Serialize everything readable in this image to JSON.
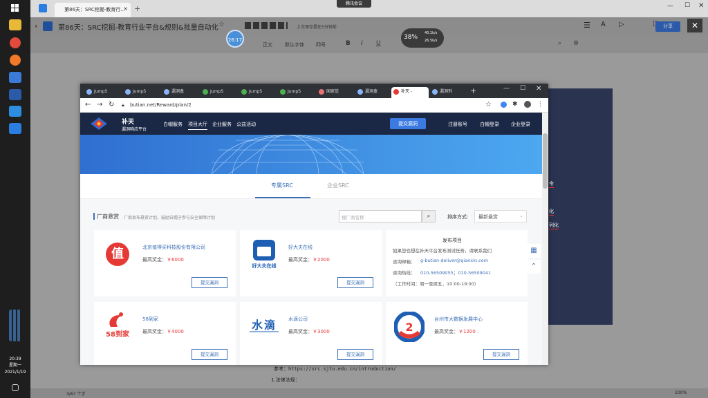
{
  "taskbar": {
    "time": "20:39",
    "weekday": "星期一",
    "date": "2021/1/19"
  },
  "meeting_badge": "腾讯会议",
  "doc_app": {
    "tab_title": "第86天：SRC挖掘-教育行...",
    "title": "第86天：SRC挖掘-教育行业平台&规则&批量自动化",
    "save_status": "上次保存是在5分钟前",
    "share_label": "分享",
    "toolbar": {
      "body_style": "正文",
      "font": "默认字体",
      "size": "四号",
      "bold": "B",
      "italic": "I",
      "underline": "U"
    },
    "timer": "26:17",
    "speed": {
      "percent": "38%",
      "up": "40.1k/s",
      "down": "26.5k/s"
    },
    "side_texts": [
      "令",
      "化",
      "列化"
    ],
    "body_lines": [
      "参考：https://src.sjtu.edu.cn/introduction/",
      "1.法律法规："
    ],
    "status_pages": "3/67 个字",
    "zoom": "100%"
  },
  "browser": {
    "tabs": [
      "JumpS",
      "JumpS",
      "漏洞盒",
      "JumpS",
      "JumpS",
      "JumpS",
      "国家信",
      "漏洞盒",
      "补天 -",
      "漏洞列"
    ],
    "active_tab_index": 8,
    "url": "butian.net/Reward/plan/2"
  },
  "site": {
    "brand": "补天",
    "brand_sub": "漏洞响应平台",
    "nav": [
      "白帽服务",
      "项目大厅",
      "企业服务",
      "公益活动"
    ],
    "submit_vuln": "提交漏洞",
    "register": "注册账号",
    "whitehat_login": "白帽登录",
    "company_login": "企业登录",
    "tabs": [
      "专属SRC",
      "企业SRC"
    ],
    "section_title": "厂商悬赏",
    "section_desc": "厂商发布悬赏计划，鼓励白帽子参与安全保障计划",
    "search_placeholder": "搜厂商名称",
    "sort_label": "排序方式:",
    "sort_value": "最新悬赏",
    "cards": [
      {
        "name": "北京值得买科技股份有限公司",
        "reward_label": "最高奖金：",
        "reward": "￥6000",
        "button": "提交漏洞",
        "logo": "值"
      },
      {
        "name": "好大夫在线",
        "reward_label": "最高奖金：",
        "reward": "￥2000",
        "button": "提交漏洞",
        "logo": "好大夫在线"
      },
      {
        "name": "58到家",
        "reward_label": "最高奖金：",
        "reward": "￥4000",
        "button": "提交漏洞",
        "logo": "58到家"
      },
      {
        "name": "水滴公司",
        "reward_label": "最高奖金：",
        "reward": "￥3000",
        "button": "提交漏洞",
        "logo": "水滴"
      },
      {
        "name": "台州市大数据发展中心",
        "reward_label": "最高奖金：",
        "reward": "￥1200",
        "button": "提交漏洞",
        "logo": ""
      }
    ],
    "publish": {
      "title": "发布项目",
      "desc": "如果您也想在补天平台发布测试任务，请联系我们",
      "email_label": "咨询邮箱：",
      "email": "g-butian-deliver@qianxin.com",
      "phone_label": "咨询热线：",
      "phone": "010-56509055；010-56509041",
      "hours": "（工作时间：周一至周五，10:00-19:00）"
    }
  }
}
